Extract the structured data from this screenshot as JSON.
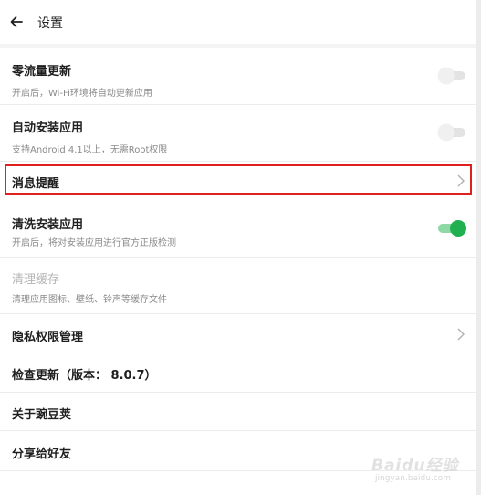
{
  "header": {
    "title": "设置",
    "back_icon": "arrow-left-icon"
  },
  "settings": [
    {
      "label": "零流量更新",
      "sub": "开启后，Wi-Fi环境将自动更新应用",
      "control": "toggle",
      "state": "off"
    },
    {
      "label": "自动安装应用",
      "sub": "支持Android 4.1以上，无需Root权限",
      "control": "toggle",
      "state": "off"
    },
    {
      "label": "消息提醒",
      "control": "chevron",
      "highlighted": true
    },
    {
      "label": "清洗安装应用",
      "sub": "开启后，将对安装应用进行官方正版检测",
      "control": "toggle",
      "state": "on"
    },
    {
      "label": "清理缓存",
      "sub": "清理应用图标、壁纸、铃声等缓存文件",
      "disabled": true
    },
    {
      "label": "隐私权限管理",
      "control": "chevron"
    },
    {
      "label": "检查更新（版本： 8.0.7）"
    },
    {
      "label": "关于豌豆荚"
    },
    {
      "label": "分享给好友"
    }
  ],
  "colors": {
    "toggle_on": "#20b050",
    "toggle_on_track": "#8ed8a6",
    "toggle_off_track": "#e3e3e3",
    "highlight": "#e0201f"
  },
  "watermark": {
    "text": "Baidu经验",
    "url": "jingyan.baidu.com"
  }
}
